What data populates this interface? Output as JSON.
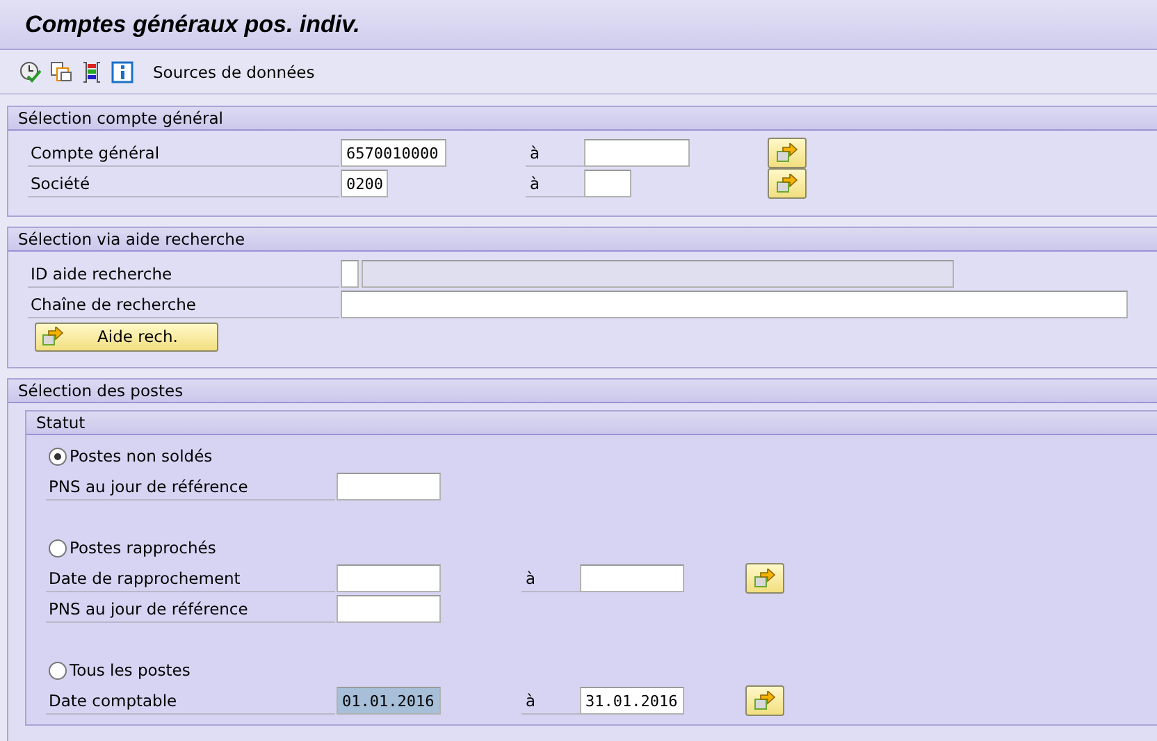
{
  "window": {
    "title": "Comptes généraux pos. indiv."
  },
  "toolbar": {
    "label": "Sources de données"
  },
  "sections": [
    {
      "title": "Sélection compte général",
      "rows": [
        {
          "kind": "range",
          "label": "Compte général",
          "from": {
            "kind": "account",
            "value": "6570010000",
            "selected": false
          },
          "to_label": "à",
          "to": {
            "kind": "account",
            "selected": false
          }
        },
        {
          "kind": "range",
          "label": "Société",
          "from": {
            "kind": "company",
            "value": "0200",
            "selected": false
          },
          "to_label": "à",
          "to": {
            "kind": "company",
            "selected": false
          }
        }
      ]
    },
    {
      "title": "Sélection via aide recherche",
      "rows": [
        {
          "kind": "pair",
          "label": "ID aide recherche",
          "fields": [
            {
              "kind": "id",
              "disabled": false,
              "selected": false
            },
            {
              "kind": "description",
              "disabled": true,
              "selected": false
            }
          ]
        },
        {
          "kind": "single",
          "label": "Chaîne de recherche",
          "field": {
            "kind": "long",
            "selected": false
          }
        },
        {
          "kind": "button",
          "label": "Aide rech."
        }
      ]
    },
    {
      "title": "Sélection des postes",
      "frames": [
        {
          "title": "Statut",
          "rows": [
            {
              "kind": "radio",
              "label": "Postes non soldés",
              "selected": true
            },
            {
              "kind": "single",
              "label": "PNS au jour de référence",
              "field": {
                "kind": "date",
                "selected": false
              }
            },
            {
              "kind": "radio",
              "label": "Postes rapprochés",
              "selected": false
            },
            {
              "kind": "range",
              "label": "Date de rapprochement",
              "from": {
                "kind": "date",
                "selected": false
              },
              "to_label": "à",
              "to": {
                "kind": "date",
                "selected": false
              }
            },
            {
              "kind": "single",
              "label": "PNS au jour de référence",
              "field": {
                "kind": "date",
                "selected": false
              }
            },
            {
              "kind": "radio",
              "label": "Tous les postes",
              "selected": false
            },
            {
              "kind": "range",
              "label": "Date comptable",
              "from": {
                "kind": "date",
                "value": "01.01.2016",
                "selected": true
              },
              "to_label": "à",
              "to": {
                "kind": "date",
                "value": "31.01.2016",
                "selected": false
              }
            }
          ]
        }
      ]
    }
  ]
}
